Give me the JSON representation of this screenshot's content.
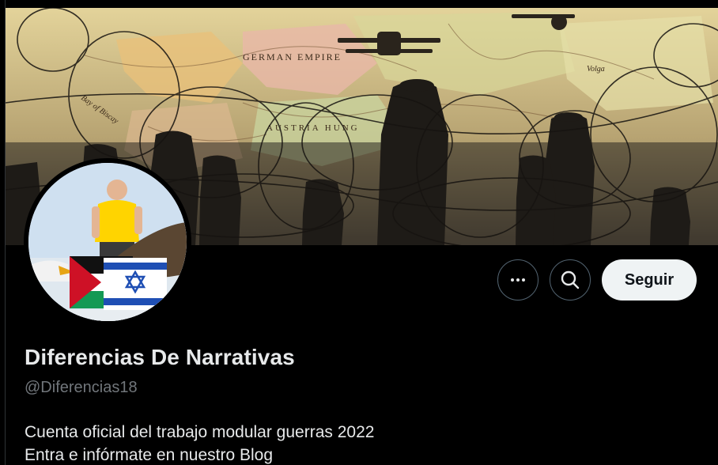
{
  "profile": {
    "display_name": "Diferencias De Narrativas",
    "handle": "@Diferencias18",
    "bio_lines": [
      "Cuenta oficial del trabajo modular guerras 2022",
      "Entra e infórmate en nuestro Blog"
    ]
  },
  "banner": {
    "map_labels": [
      "GERMAN EMPIRE",
      "AUSTRIA HUNG",
      "Bay of Biscay",
      "Volga"
    ]
  },
  "actions": {
    "more_icon": "more-horizontal-icon",
    "search_icon": "search-icon",
    "follow_label": "Seguir"
  },
  "colors": {
    "background": "#000000",
    "primary_text": "#e7e9ea",
    "secondary_text": "#71767b",
    "button_border": "#536471",
    "follow_bg": "#eff3f4",
    "follow_text": "#0f1419"
  }
}
